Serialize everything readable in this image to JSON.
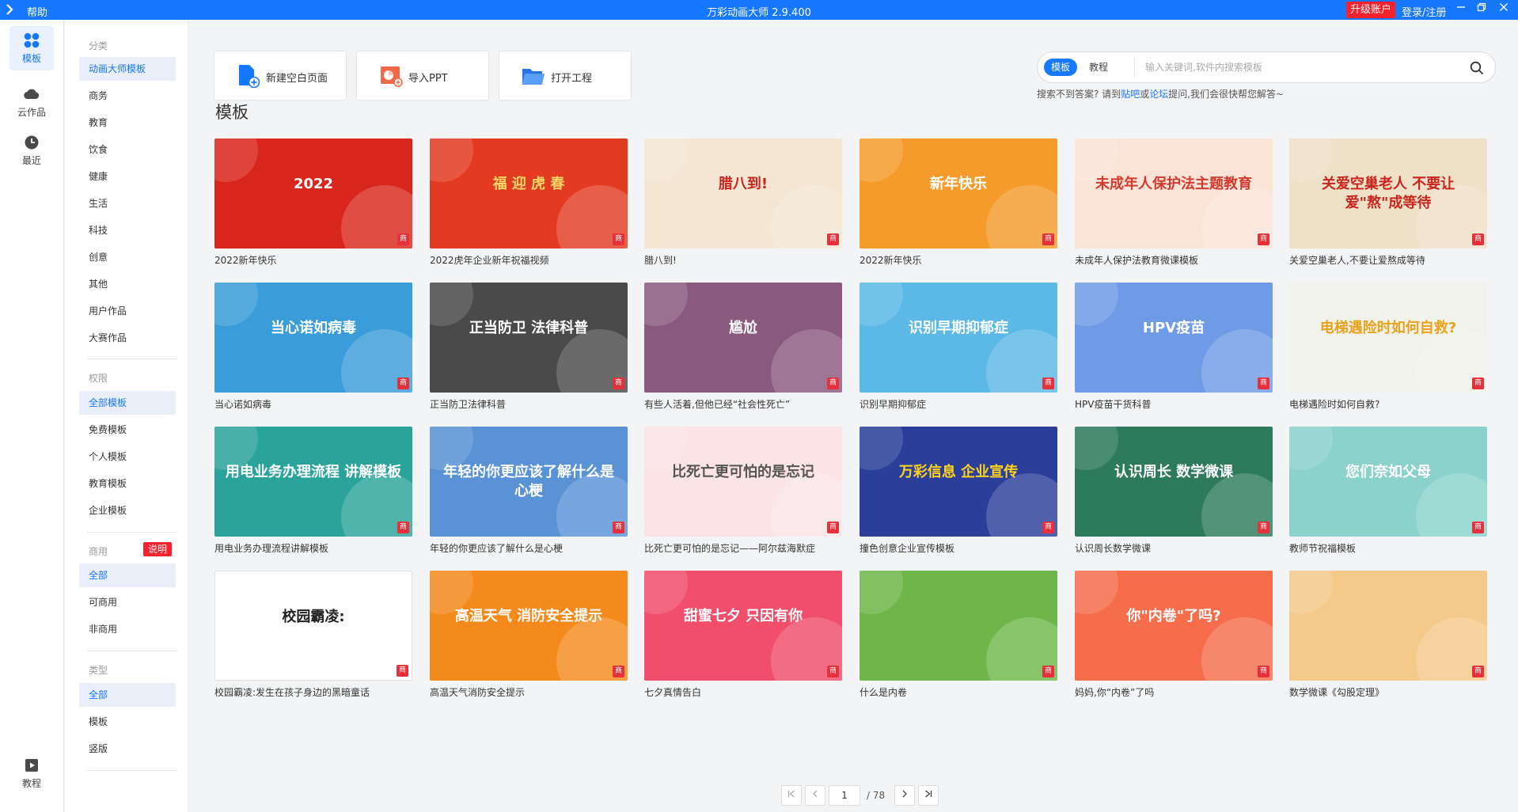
{
  "titlebar": {
    "menu_help": "帮助",
    "title": "万彩动画大师 2.9.400",
    "upgrade": "升级账户",
    "login": "登录/注册"
  },
  "rail": [
    {
      "label": "模板",
      "icon": "grid-icon"
    },
    {
      "label": "云作品",
      "icon": "cloud-icon"
    },
    {
      "label": "最近",
      "icon": "clock-icon"
    },
    {
      "label": "教程",
      "icon": "play-icon"
    }
  ],
  "catbar": {
    "group1": {
      "heading": "分类",
      "items": [
        "动画大师模板",
        "商务",
        "教育",
        "饮食",
        "健康",
        "生活",
        "科技",
        "创意",
        "其他",
        "用户作品",
        "大赛作品"
      ]
    },
    "group2": {
      "heading": "权限",
      "items": [
        "全部模板",
        "免费模板",
        "个人模板",
        "教育模板",
        "企业模板"
      ]
    },
    "group3": {
      "heading": "商用",
      "badge": "说明",
      "items": [
        "全部",
        "可商用",
        "非商用"
      ]
    },
    "group4": {
      "heading": "类型",
      "items": [
        "全部",
        "模板",
        "竖版"
      ]
    }
  },
  "actions": {
    "new_blank": "新建空白页面",
    "import_ppt": "导入PPT",
    "open_project": "打开工程"
  },
  "search": {
    "tab_template": "模板",
    "tab_tutorial": "教程",
    "placeholder": "输入关键词,软件内搜索模板",
    "hint_prefix": "搜索不到答案?  请到",
    "hint_link1": "贴吧",
    "hint_mid": "或",
    "hint_link2": "论坛",
    "hint_suffix": "提问,我们会很快帮您解答~"
  },
  "section_title": "模板",
  "commercial_badge": "商",
  "cards": [
    {
      "title": "2022新年快乐",
      "art": "2022",
      "bg": "#d9261c",
      "fg": "#ffffff"
    },
    {
      "title": "2022虎年企业新年祝福视频",
      "art": "福 迎 虎 春",
      "bg": "#e23b22",
      "fg": "#ffd766"
    },
    {
      "title": "腊八到!",
      "art": "腊八到!",
      "bg": "#f4e6d3",
      "fg": "#c8261c"
    },
    {
      "title": "2022新年快乐",
      "art": "新年快乐",
      "bg": "#f49b2c",
      "fg": "#ffffff"
    },
    {
      "title": "未成年人保护法教育微课模板",
      "art": "未成年人保护法主题教育",
      "bg": "#fbe3d8",
      "fg": "#d23a2e"
    },
    {
      "title": "关爱空巢老人,不要让爱熬成等待",
      "art": "关爱空巢老人 不要让爱\"熬\"成等待",
      "bg": "#efe0c8",
      "fg": "#c8261c"
    },
    {
      "title": "当心诺如病毒",
      "art": "当心诺如病毒",
      "bg": "#3a9cd8",
      "fg": "#ffffff"
    },
    {
      "title": "正当防卫法律科普",
      "art": "正当防卫 法律科普",
      "bg": "#4a4a4a",
      "fg": "#ffffff"
    },
    {
      "title": "有些人活着,但他已经“社会性死亡”",
      "art": "尴尬",
      "bg": "#8a5a7e",
      "fg": "#ffffff"
    },
    {
      "title": "识别早期抑郁症",
      "art": "识别早期抑郁症",
      "bg": "#5cb8e6",
      "fg": "#ffffff"
    },
    {
      "title": "HPV疫苗干货科普",
      "art": "HPV疫苗",
      "bg": "#6f9be6",
      "fg": "#ffffff"
    },
    {
      "title": "电梯遇险时如何自救?",
      "art": "电梯遇险时如何自救?",
      "bg": "#f2f2ec",
      "fg": "#e8a21c"
    },
    {
      "title": "用电业务办理流程讲解模板",
      "art": "用电业务办理流程 讲解模板",
      "bg": "#2aa39a",
      "fg": "#ffffff"
    },
    {
      "title": "年轻的你更应该了解什么是心梗",
      "art": "年轻的你更应该了解什么是心梗",
      "bg": "#5a92d6",
      "fg": "#ffffff"
    },
    {
      "title": "比死亡更可怕的是忘记——阿尔兹海默症",
      "art": "比死亡更可怕的是忘记",
      "bg": "#fbe3e6",
      "fg": "#555555"
    },
    {
      "title": "撞色创意企业宣传模板",
      "art": "万彩信息 企业宣传",
      "bg": "#2b3e9a",
      "fg": "#ffd21c"
    },
    {
      "title": "认识周长数学微课",
      "art": "认识周长 数学微课",
      "bg": "#2d7a5c",
      "fg": "#ffffff"
    },
    {
      "title": "教师节祝福模板",
      "art": "您们奈如父母",
      "bg": "#8cd2cc",
      "fg": "#ffffff"
    },
    {
      "title": "校园霸凌:发生在孩子身边的黑暗童话",
      "art": "校园霸凌:",
      "bg": "#ffffff",
      "fg": "#222222"
    },
    {
      "title": "高温天气消防安全提示",
      "art": "高温天气 消防安全提示",
      "bg": "#f48a1c",
      "fg": "#ffffff"
    },
    {
      "title": "七夕真情告白",
      "art": "甜蜜七夕 只因有你",
      "bg": "#f04e6a",
      "fg": "#ffffff"
    },
    {
      "title": "什么是内卷",
      "art": "",
      "bg": "#6fb64a",
      "fg": "#ffffff"
    },
    {
      "title": "妈妈,你“内卷”了吗",
      "art": "你\"内卷\"了吗?",
      "bg": "#f56d4b",
      "fg": "#ffffff"
    },
    {
      "title": "数学微课《勾股定理》",
      "art": "",
      "bg": "#f4c98a",
      "fg": "#ffffff"
    }
  ],
  "pager": {
    "current": "1",
    "total": "/ 78"
  },
  "colors": {
    "accent": "#1677ff",
    "badge_red": "#e8303a"
  }
}
